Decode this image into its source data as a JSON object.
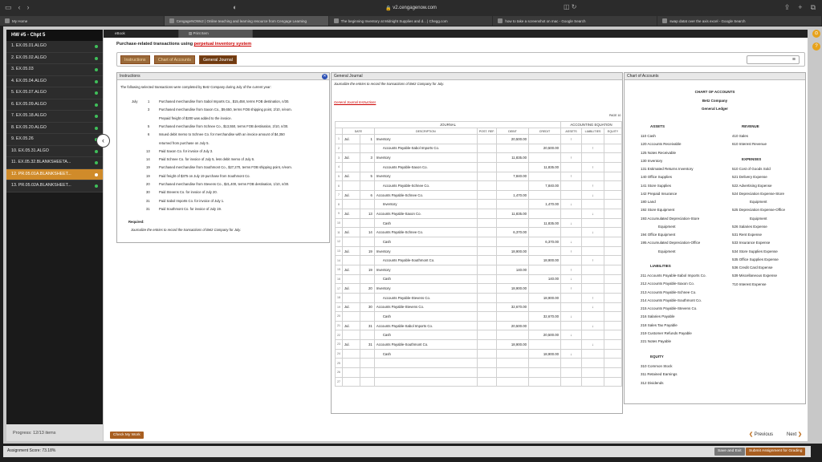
{
  "browser": {
    "url": "v2.cengagenow.com",
    "tabs": [
      "My Home",
      "CengageNOWv2 | Online teaching and learning resource from Cengage Learning",
      "The beginning Inventory at Midnight Supplies and d... | Chegg.com",
      "how to take a screenshot on mac - Google Search",
      "swap datat over the axis excel - Google Search"
    ]
  },
  "sidebar": {
    "title": "HW #5 - Chpt 5",
    "items": [
      {
        "label": "1. EX.05.01.ALGO",
        "active": false
      },
      {
        "label": "2. EX.05.02.ALGO",
        "active": false
      },
      {
        "label": "3. EX.05.03",
        "active": false
      },
      {
        "label": "4. EX.05.04.ALGO",
        "active": false
      },
      {
        "label": "5. EX.05.07.ALGO",
        "active": false
      },
      {
        "label": "6. EX.05.09.ALGO",
        "active": false
      },
      {
        "label": "7. EX.05.18.ALGO",
        "active": false
      },
      {
        "label": "8. EX.05.20.ALGO",
        "active": false
      },
      {
        "label": "9. EX.05.26",
        "active": false
      },
      {
        "label": "10. EX.05.31.ALGO",
        "active": false
      },
      {
        "label": "11. EX.05.32.BLANKSHEETA...",
        "active": false
      },
      {
        "label": "12. PR.05.01A.BLANKSHEET...",
        "active": true
      },
      {
        "label": "13. PR.05.02A.BLANKSHEET...",
        "active": false
      }
    ],
    "progress": "Progress:  12/13 items"
  },
  "main_tabs": {
    "ebook": "eBook",
    "print": "Print Item"
  },
  "heading": {
    "prefix": "Purchase-related transactions using ",
    "link": "perpetual inventory system"
  },
  "pills": {
    "instructions": "Instructions",
    "coa": "Chart of Accounts",
    "gj": "General Journal"
  },
  "instructions": {
    "title": "Instructions",
    "intro": "The following selected transactions were completed by Betz Company during July of the current year:",
    "month": "July",
    "rows": [
      {
        "day": "1",
        "text": "Purchased merchandise from Sabol Imports Co., $15,458, terms FOB destination, n/30."
      },
      {
        "day": "3",
        "text": "Purchased merchandise from Saxon Co., $9,650, terms FOB shipping point, 2/10, n/eom."
      },
      {
        "day": "",
        "text": "Prepaid freight of $200 was added to the invoice."
      },
      {
        "day": "5",
        "text": "Purchased merchandise from Schnee Co., $13,550, terms FOB destination, 2/10, n/30."
      },
      {
        "day": "6",
        "text": "Issued debit memo to Schnee Co. for merchandise with an invoice amount of $4,350"
      },
      {
        "day": "",
        "text": "returned from purchase on July 5."
      },
      {
        "day": "13",
        "text": "Paid Saxon Co. for invoice of July 3."
      },
      {
        "day": "14",
        "text": "Paid Schnee Co. for invoice of July 5, less debit memo of July 6."
      },
      {
        "day": "19",
        "text": "Purchased merchandise from Southmont Co., $27,270, terms FOB shipping point, n/eom."
      },
      {
        "day": "19",
        "text": "Paid freight of $375 on July 19 purchase from Southmont Co."
      },
      {
        "day": "20",
        "text": "Purchased merchandise from Stevens Co., $21,400, terms FOB destination, 1/10, n/30."
      },
      {
        "day": "30",
        "text": "Paid Stevens Co. for invoice of July 20."
      },
      {
        "day": "31",
        "text": "Paid Sabol Imports Co. for invoice of July 1."
      },
      {
        "day": "31",
        "text": "Paid Southmont Co. for invoice of July 19."
      }
    ],
    "required_label": "Required:",
    "required_text": "Journalize the entries to record the transactions of Betz Company for July."
  },
  "journal": {
    "title": "General Journal",
    "subtitle": "Journalize the entries to record the transactions of Betz Company for July.",
    "link": "General Journal Instructions",
    "page": "PAGE 10",
    "caption": "JOURNAL",
    "acc_eq": "ACCOUNTING EQUATION",
    "cols": [
      "DATE",
      "DESCRIPTION",
      "POST. REF.",
      "DEBIT",
      "CREDIT",
      "ASSETS",
      "LIABILITIES",
      "EQUITY"
    ],
    "rows": [
      {
        "n": "1",
        "m": "Jul.",
        "d": "1",
        "desc": "Inventory",
        "ind": false,
        "dr": "20,500.00",
        "cr": "",
        "a": "↑",
        "l": "",
        "e": ""
      },
      {
        "n": "2",
        "m": "",
        "d": "",
        "desc": "Accounts Payable-Sabol Imports Co.",
        "ind": true,
        "dr": "",
        "cr": "20,500.00",
        "a": "",
        "l": "↑",
        "e": ""
      },
      {
        "n": "3",
        "m": "Jul.",
        "d": "3",
        "desc": "Inventory",
        "ind": false,
        "dr": "11,835.00",
        "cr": "",
        "a": "↑",
        "l": "",
        "e": ""
      },
      {
        "n": "4",
        "m": "",
        "d": "",
        "desc": "Accounts Payable-Saxon Co.",
        "ind": true,
        "dr": "",
        "cr": "11,835.00",
        "a": "",
        "l": "↑",
        "e": ""
      },
      {
        "n": "5",
        "m": "Jul.",
        "d": "5",
        "desc": "Inventory",
        "ind": false,
        "dr": "7,840.00",
        "cr": "",
        "a": "↑",
        "l": "",
        "e": ""
      },
      {
        "n": "6",
        "m": "",
        "d": "",
        "desc": "Accounts Payable-Schnee Co.",
        "ind": true,
        "dr": "",
        "cr": "7,840.00",
        "a": "",
        "l": "↑",
        "e": ""
      },
      {
        "n": "7",
        "m": "Jul.",
        "d": "6",
        "desc": "Accounts Payable-Schnee Co.",
        "ind": false,
        "dr": "1,470.00",
        "cr": "",
        "a": "",
        "l": "↓",
        "e": ""
      },
      {
        "n": "8",
        "m": "",
        "d": "",
        "desc": "Inventory",
        "ind": true,
        "dr": "",
        "cr": "1,470.00",
        "a": "↓",
        "l": "",
        "e": ""
      },
      {
        "n": "9",
        "m": "Jul.",
        "d": "13",
        "desc": "Accounts Payable-Saxon Co.",
        "ind": false,
        "dr": "11,835.00",
        "cr": "",
        "a": "",
        "l": "↓",
        "e": ""
      },
      {
        "n": "10",
        "m": "",
        "d": "",
        "desc": "Cash",
        "ind": true,
        "dr": "",
        "cr": "11,835.00",
        "a": "↓",
        "l": "",
        "e": ""
      },
      {
        "n": "11",
        "m": "Jul.",
        "d": "14",
        "desc": "Accounts Payable-Schnee Co.",
        "ind": false,
        "dr": "6,370.00",
        "cr": "",
        "a": "",
        "l": "↓",
        "e": ""
      },
      {
        "n": "12",
        "m": "",
        "d": "",
        "desc": "Cash",
        "ind": true,
        "dr": "",
        "cr": "6,370.00",
        "a": "↓",
        "l": "",
        "e": ""
      },
      {
        "n": "13",
        "m": "Jul.",
        "d": "19",
        "desc": "Inventory",
        "ind": false,
        "dr": "18,900.00",
        "cr": "",
        "a": "↑",
        "l": "",
        "e": ""
      },
      {
        "n": "14",
        "m": "",
        "d": "",
        "desc": "Accounts Payable-Southmont Co.",
        "ind": true,
        "dr": "",
        "cr": "18,900.00",
        "a": "",
        "l": "↑",
        "e": ""
      },
      {
        "n": "15",
        "m": "Jul.",
        "d": "19",
        "desc": "Inventory",
        "ind": false,
        "dr": "140.00",
        "cr": "",
        "a": "↑",
        "l": "",
        "e": ""
      },
      {
        "n": "16",
        "m": "",
        "d": "",
        "desc": "Cash",
        "ind": true,
        "dr": "",
        "cr": "140.00",
        "a": "↓",
        "l": "",
        "e": ""
      },
      {
        "n": "17",
        "m": "Jul.",
        "d": "20",
        "desc": "Inventory",
        "ind": false,
        "dr": "18,900.00",
        "cr": "",
        "a": "↑",
        "l": "",
        "e": ""
      },
      {
        "n": "18",
        "m": "",
        "d": "",
        "desc": "Accounts Payable-Stevens Co.",
        "ind": true,
        "dr": "",
        "cr": "18,900.00",
        "a": "",
        "l": "↑",
        "e": ""
      },
      {
        "n": "19",
        "m": "Jul.",
        "d": "30",
        "desc": "Accounts Payable-Stevens Co.",
        "ind": false,
        "dr": "32,670.00",
        "cr": "",
        "a": "",
        "l": "↓",
        "e": ""
      },
      {
        "n": "20",
        "m": "",
        "d": "",
        "desc": "Cash",
        "ind": true,
        "dr": "",
        "cr": "32,670.00",
        "a": "↓",
        "l": "",
        "e": ""
      },
      {
        "n": "21",
        "m": "Jul.",
        "d": "31",
        "desc": "Accounts Payable-Sabol Imports Co.",
        "ind": false,
        "dr": "20,500.00",
        "cr": "",
        "a": "",
        "l": "↓",
        "e": ""
      },
      {
        "n": "22",
        "m": "",
        "d": "",
        "desc": "Cash",
        "ind": true,
        "dr": "",
        "cr": "20,500.00",
        "a": "↓",
        "l": "",
        "e": ""
      },
      {
        "n": "23",
        "m": "Jul.",
        "d": "31",
        "desc": "Accounts Payable-Southmont Co.",
        "ind": false,
        "dr": "18,900.00",
        "cr": "",
        "a": "",
        "l": "↓",
        "e": ""
      },
      {
        "n": "24",
        "m": "",
        "d": "",
        "desc": "Cash",
        "ind": true,
        "dr": "",
        "cr": "18,900.00",
        "a": "↓",
        "l": "",
        "e": ""
      },
      {
        "n": "25",
        "m": "",
        "d": "",
        "desc": "",
        "ind": false,
        "dr": "",
        "cr": "",
        "a": "",
        "l": "",
        "e": ""
      },
      {
        "n": "26",
        "m": "",
        "d": "",
        "desc": "",
        "ind": false,
        "dr": "",
        "cr": "",
        "a": "",
        "l": "",
        "e": ""
      },
      {
        "n": "27",
        "m": "",
        "d": "",
        "desc": "",
        "ind": false,
        "dr": "",
        "cr": "",
        "a": "",
        "l": "",
        "e": ""
      }
    ]
  },
  "coa": {
    "title": "Chart of Accounts",
    "h1": "CHART OF ACCOUNTS",
    "company": "Betz Company",
    "ledger": "General Ledger",
    "assets_h": "ASSETS",
    "assets": [
      "110  Cash",
      "120  Accounts Receivable",
      "125  Notes Receivable",
      "130  Inventory",
      "131  Estimated Returns Inventory",
      "140  Office Supplies",
      "141  Store Supplies",
      "142  Prepaid Insurance",
      "180  Land",
      "192  Store Equipment",
      "193  Accumulated Depreciation-Store",
      "Equipment",
      "194  Office Equipment",
      "195  Accumulated Depreciation-Office",
      "Equipment"
    ],
    "liab_h": "LIABILITIES",
    "liab": [
      "211  Accounts Payable-Sabol Imports Co.",
      "212  Accounts Payable-Saxon Co.",
      "213  Accounts Payable-Schnee Co.",
      "214  Accounts Payable-Southmont Co.",
      "215  Accounts Payable-Stevens Co.",
      "216  Salaries Payable",
      "218  Sales Tax Payable",
      "219  Customer Refunds Payable",
      "221  Notes Payable"
    ],
    "eq_h": "EQUITY",
    "eq": [
      "310  Common Stock",
      "311  Retained Earnings",
      "312  Dividends"
    ],
    "rev_h": "REVENUE",
    "rev": [
      "410  Sales",
      "610  Interest Revenue"
    ],
    "exp_h": "EXPENSES",
    "exp": [
      "510  Cost of Goods Sold",
      "521  Delivery Expense",
      "522  Advertising Expense",
      "524  Depreciation Expense-Store",
      "Equipment",
      "525  Depreciation Expense-Office",
      "Equipment",
      "526  Salaries Expense",
      "531  Rent Expense",
      "533  Insurance Expense",
      "534  Store Supplies Expense",
      "535  Office Supplies Expense",
      "536  Credit Card Expense",
      "539  Miscellaneous Expense",
      "710  Interest Expense"
    ]
  },
  "footer": {
    "check": "Check My Work",
    "prev": "Previous",
    "next": "Next",
    "score": "Assignment Score:  73.18%",
    "save": "Save and Exit",
    "submit": "Submit Assignment for Grading"
  },
  "colors": {
    "accent": "#d08b2a",
    "brown": "#6e3b12",
    "link": "#cc0000",
    "check": "#3fbf5a"
  }
}
